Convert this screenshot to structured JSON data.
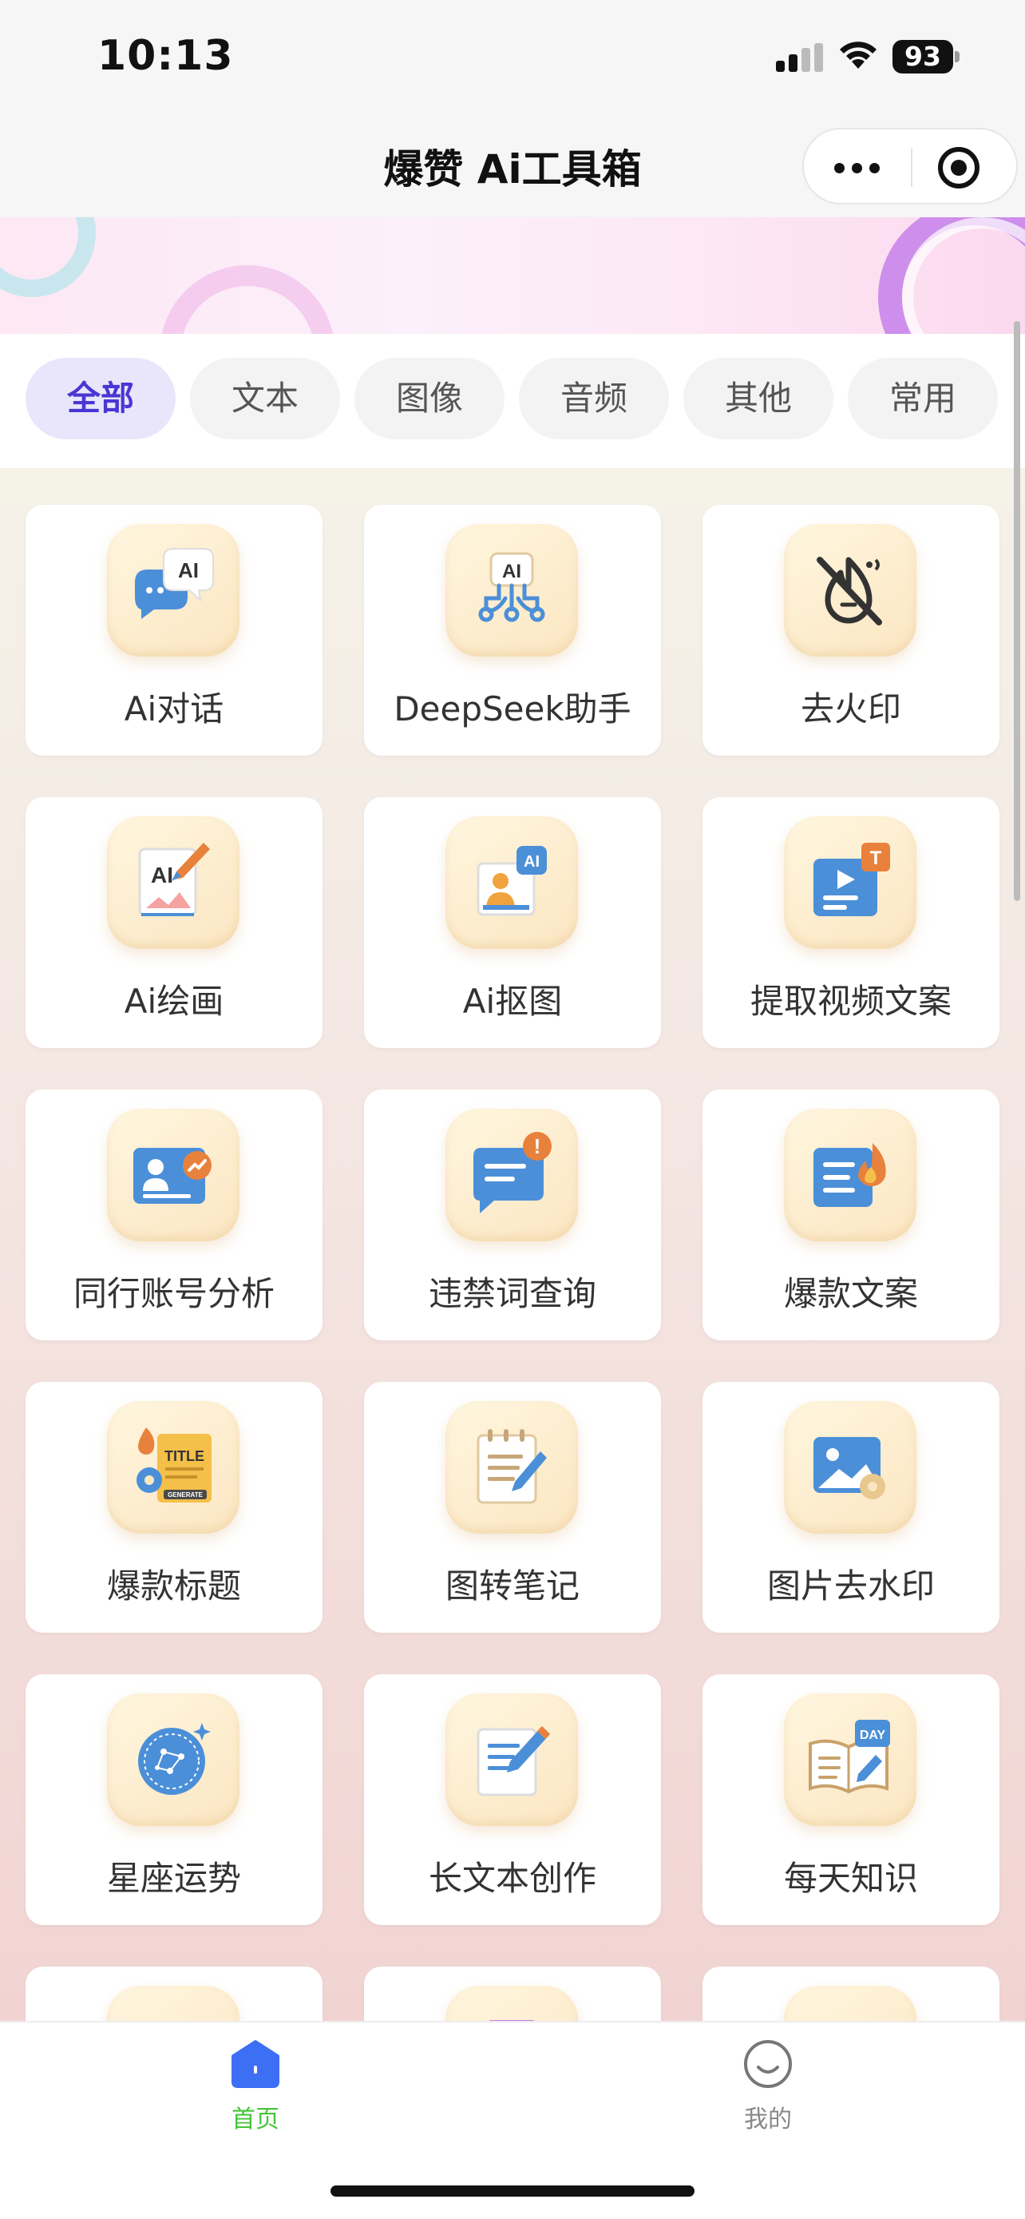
{
  "status_bar": {
    "time": "10:13",
    "battery": "93"
  },
  "header": {
    "title": "爆赞 Ai工具箱",
    "more_icon": "more-dots-icon",
    "close_icon": "target-icon"
  },
  "tabs": [
    {
      "label": "全部",
      "active": true
    },
    {
      "label": "文本",
      "active": false
    },
    {
      "label": "图像",
      "active": false
    },
    {
      "label": "音频",
      "active": false
    },
    {
      "label": "其他",
      "active": false
    },
    {
      "label": "常用",
      "active": false
    }
  ],
  "tools": [
    {
      "label": "Ai对话",
      "icon": "chat-ai-icon"
    },
    {
      "label": "DeepSeek助手",
      "icon": "ai-robot-icon"
    },
    {
      "label": "去火印",
      "icon": "no-fire-icon"
    },
    {
      "label": "Ai绘画",
      "icon": "ai-paint-icon"
    },
    {
      "label": "Ai抠图",
      "icon": "ai-cutout-icon"
    },
    {
      "label": "提取视频文案",
      "icon": "video-text-icon"
    },
    {
      "label": "同行账号分析",
      "icon": "account-analysis-icon"
    },
    {
      "label": "违禁词查询",
      "icon": "banned-word-icon"
    },
    {
      "label": "爆款文案",
      "icon": "hot-copy-icon"
    },
    {
      "label": "爆款标题",
      "icon": "title-generate-icon"
    },
    {
      "label": "图转笔记",
      "icon": "notes-icon"
    },
    {
      "label": "图片去水印",
      "icon": "image-watermark-icon"
    },
    {
      "label": "星座运势",
      "icon": "zodiac-icon"
    },
    {
      "label": "长文本创作",
      "icon": "long-text-icon"
    },
    {
      "label": "每天知识",
      "icon": "daily-knowledge-icon"
    }
  ],
  "icon_text": {
    "ai": "AI",
    "title": "TITLE",
    "generate": "GENERATE",
    "t": "T",
    "day": "DAY",
    "exclaim": "!"
  },
  "nav": [
    {
      "label": "首页",
      "active": true,
      "icon": "home-icon"
    },
    {
      "label": "我的",
      "active": false,
      "icon": "profile-icon"
    }
  ],
  "colors": {
    "accent": "#4a36d3",
    "nav_active": "#44c43a",
    "home_icon": "#3d6ff5"
  }
}
